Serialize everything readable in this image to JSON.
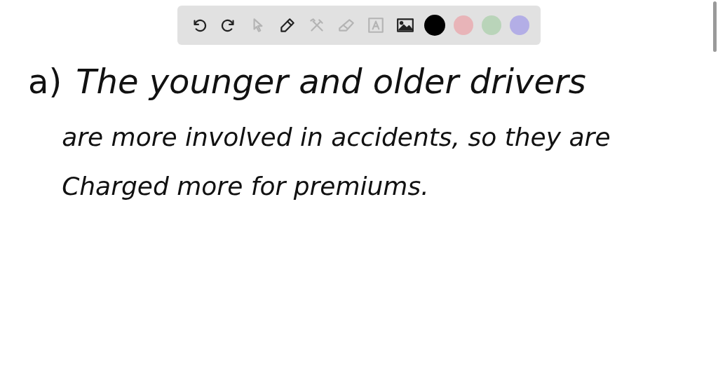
{
  "toolbar": {
    "tools": [
      {
        "kind": "undo",
        "disabled": false
      },
      {
        "kind": "redo",
        "disabled": false
      },
      {
        "kind": "pointer",
        "disabled": true
      },
      {
        "kind": "pen",
        "disabled": false
      },
      {
        "kind": "tools",
        "disabled": true
      },
      {
        "kind": "eraser",
        "disabled": true
      },
      {
        "kind": "text",
        "disabled": true
      },
      {
        "kind": "image",
        "disabled": false
      }
    ],
    "colors": [
      {
        "color": "#000000",
        "selected": true
      },
      {
        "color": "#e8b4b8",
        "selected": false
      },
      {
        "color": "#b9d4b9",
        "selected": false
      },
      {
        "color": "#b3aee6",
        "selected": false
      }
    ]
  },
  "answer": {
    "label": "a)",
    "lines": [
      "The younger and older drivers",
      "are more involved in accidents, so they are",
      "Charged more for premiums."
    ]
  }
}
